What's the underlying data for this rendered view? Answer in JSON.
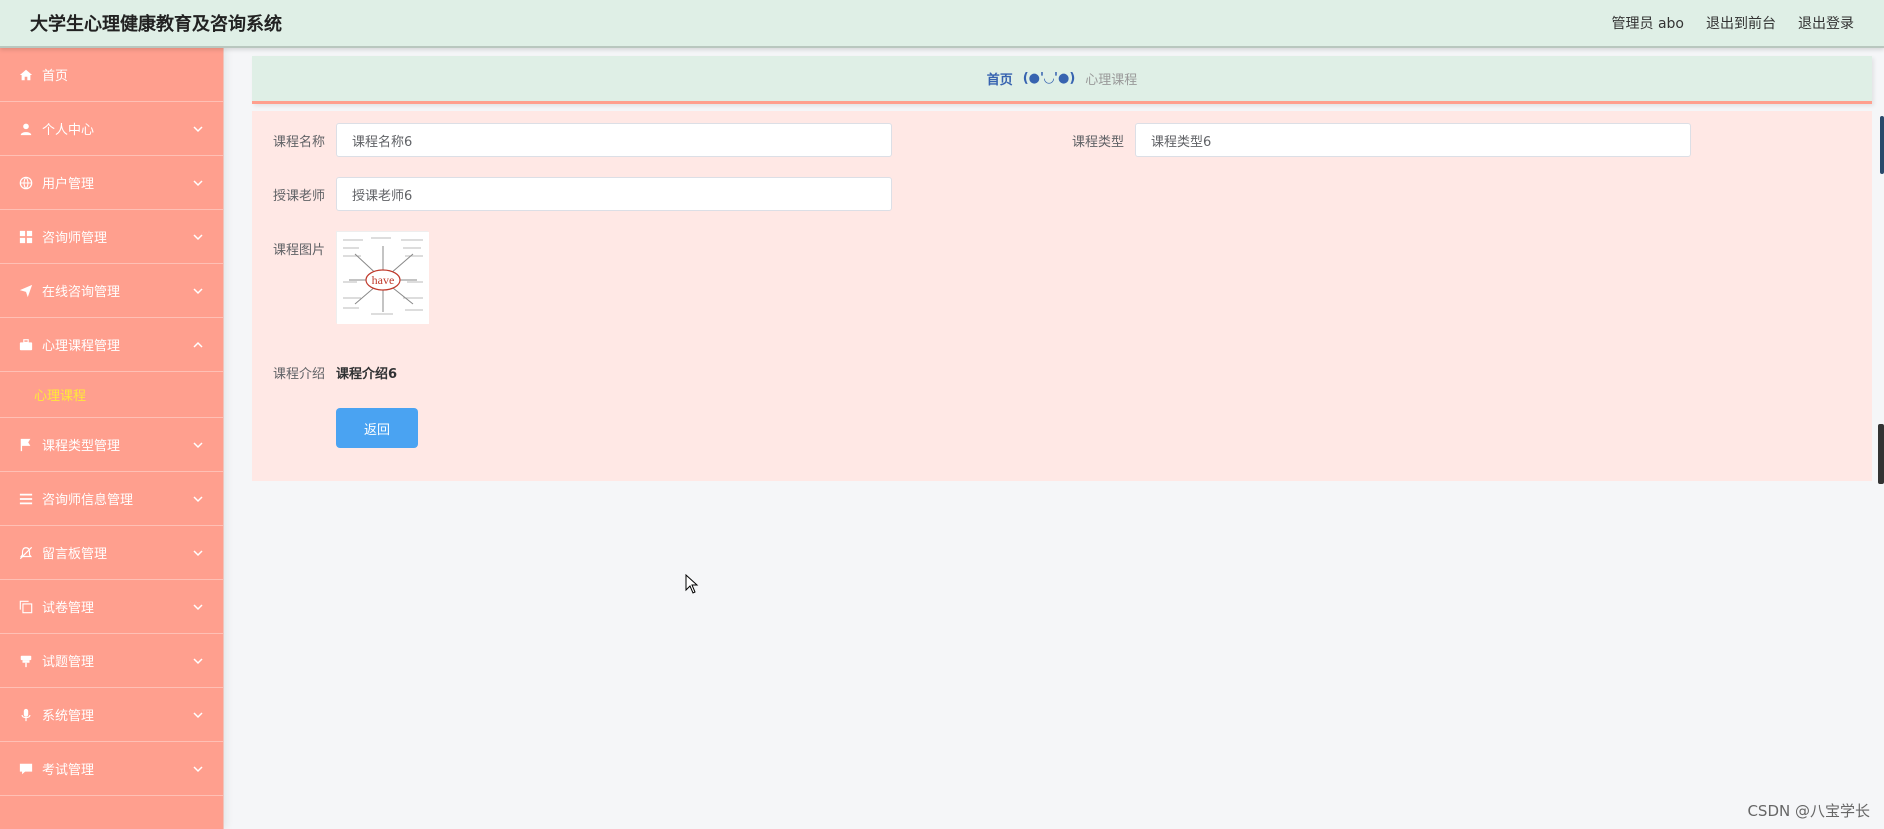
{
  "app": {
    "title": "大学生心理健康教育及咨询系统",
    "user_label": "管理员 abo",
    "to_front": "退出到前台",
    "logout": "退出登录"
  },
  "sidebar": {
    "items": [
      {
        "label": "首页",
        "icon": "home-icon"
      },
      {
        "label": "个人中心",
        "icon": "user-icon"
      },
      {
        "label": "用户管理",
        "icon": "globe-icon"
      },
      {
        "label": "咨询师管理",
        "icon": "grid-icon"
      },
      {
        "label": "在线咨询管理",
        "icon": "send-icon"
      },
      {
        "label": "心理课程管理",
        "icon": "briefcase-icon",
        "expanded": true
      },
      {
        "label": "课程类型管理",
        "icon": "flag-icon"
      },
      {
        "label": "咨询师信息管理",
        "icon": "list-icon"
      },
      {
        "label": "留言板管理",
        "icon": "bell-off-icon"
      },
      {
        "label": "试卷管理",
        "icon": "copy-icon"
      },
      {
        "label": "试题管理",
        "icon": "pin-icon"
      },
      {
        "label": "系统管理",
        "icon": "mic-icon"
      },
      {
        "label": "考试管理",
        "icon": "chat-icon"
      }
    ],
    "submenu": {
      "label": "心理课程"
    }
  },
  "breadcrumb": {
    "home": "首页",
    "separator": "(●'◡'●)",
    "current": "心理课程"
  },
  "form": {
    "course_name_label": "课程名称",
    "course_name_value": "课程名称6",
    "course_type_label": "课程类型",
    "course_type_value": "课程类型6",
    "teacher_label": "授课老师",
    "teacher_value": "授课老师6",
    "image_label": "课程图片",
    "image_word": "have",
    "intro_label": "课程介绍",
    "intro_value": "课程介绍6",
    "back_button": "返回"
  },
  "colors": {
    "topbar_bg": "#dfefe6",
    "sidebar_bg": "#ff9f8e",
    "active_submenu": "#ffe83a",
    "panel_bg": "#ffe8e5",
    "button_bg": "#4aa3f2"
  },
  "watermark": "CSDN @八宝学长"
}
